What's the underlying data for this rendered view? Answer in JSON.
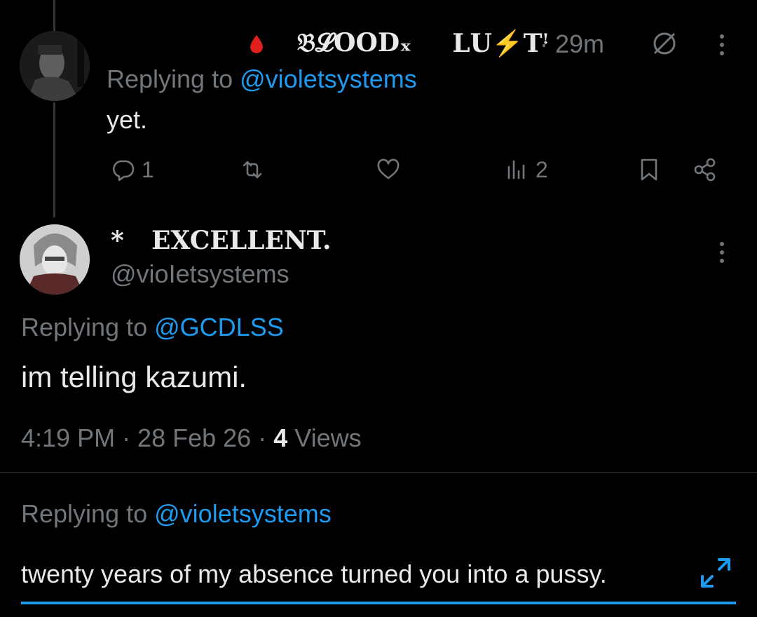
{
  "colors": {
    "background": "#000000",
    "text": "#e7e9ea",
    "secondary": "#71767b",
    "accent": "#1d9bf0",
    "blood": "#e0201c"
  },
  "parent_post": {
    "display_name_part1": "𝔅𝓛𝐎𝐎𝐃ₓ",
    "display_name_part2": "𝐋𝐔⚡𝐓ꜝ",
    "meta": "· 29m",
    "reply_prefix": "Replying to",
    "reply_to": "@violetsystems",
    "text": "yet.",
    "actions": {
      "reply_count": "1",
      "retweet_count": "",
      "like_count": "",
      "views_count": "2"
    },
    "icons": [
      "avatar",
      "blood-drop-icon",
      "no-sign-icon",
      "more-icon",
      "reply-icon",
      "retweet-icon",
      "like-icon",
      "views-icon",
      "bookmark-icon",
      "share-icon"
    ]
  },
  "main_post": {
    "star": "*",
    "display_name": "EXCELLENT.",
    "handle": "@vioIetsystems",
    "reply_prefix": "Replying to",
    "reply_to": "@GCDLSS",
    "text": "im telling kazumi.",
    "timestamp": "4:19 PM · 28 Feb 26 ·",
    "views_count": "4",
    "views_label": "Views"
  },
  "composer": {
    "reply_prefix": "Replying to",
    "reply_to": "@violetsystems",
    "draft_text": "twenty years of my absence turned you into a pussy."
  }
}
